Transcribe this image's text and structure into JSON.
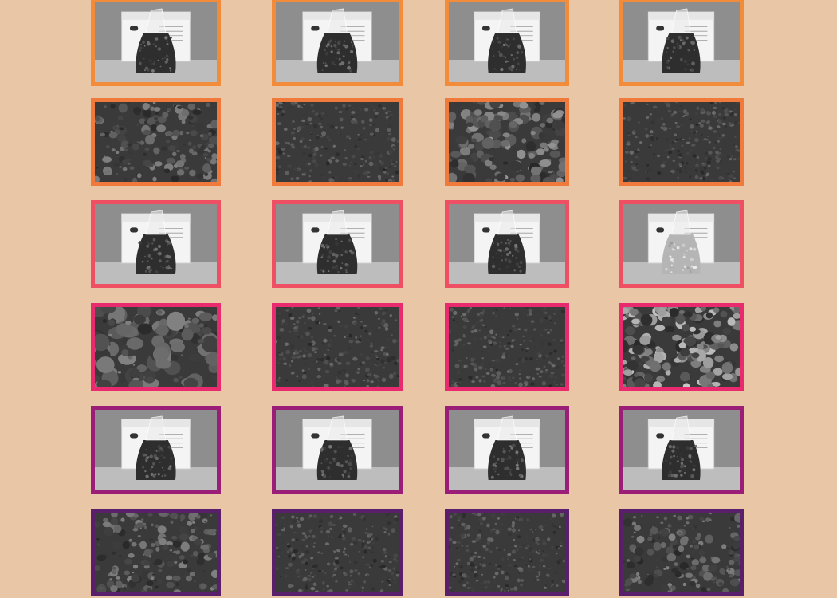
{
  "background_color": "#e8c6a6",
  "frame_colors_by_row": [
    "#f28c3a",
    "#f07a3c",
    "#ee4f62",
    "#ea2a6e",
    "#9a1e78",
    "#5a1f6a"
  ],
  "photos": [
    {
      "kind": "bag-photo",
      "fill": "dark-soil"
    },
    {
      "kind": "bag-photo",
      "fill": "dark-soil"
    },
    {
      "kind": "bag-photo",
      "fill": "dark-soil"
    },
    {
      "kind": "bag-photo",
      "fill": "dark-soil"
    },
    {
      "kind": "soil-texture",
      "fill": "mixed-stones"
    },
    {
      "kind": "soil-texture",
      "fill": "fine-soil"
    },
    {
      "kind": "soil-texture",
      "fill": "gravel"
    },
    {
      "kind": "soil-texture",
      "fill": "fine-soil"
    },
    {
      "kind": "bag-photo",
      "fill": "dark-soil"
    },
    {
      "kind": "bag-photo",
      "fill": "dark-soil"
    },
    {
      "kind": "bag-photo",
      "fill": "dark-soil"
    },
    {
      "kind": "bag-photo",
      "fill": "light-gravel"
    },
    {
      "kind": "soil-texture",
      "fill": "large-stones"
    },
    {
      "kind": "soil-texture",
      "fill": "fine-soil"
    },
    {
      "kind": "soil-texture",
      "fill": "fine-soil"
    },
    {
      "kind": "soil-texture",
      "fill": "light-gravel"
    },
    {
      "kind": "bag-photo",
      "fill": "dark-soil"
    },
    {
      "kind": "bag-photo",
      "fill": "dark-soil"
    },
    {
      "kind": "bag-photo",
      "fill": "dark-soil"
    },
    {
      "kind": "bag-photo",
      "fill": "dark-soil"
    },
    {
      "kind": "soil-texture",
      "fill": "mixed-stones"
    },
    {
      "kind": "soil-texture",
      "fill": "fine-soil"
    },
    {
      "kind": "soil-texture",
      "fill": "fine-soil"
    },
    {
      "kind": "soil-texture",
      "fill": "mixed-stones"
    }
  ]
}
